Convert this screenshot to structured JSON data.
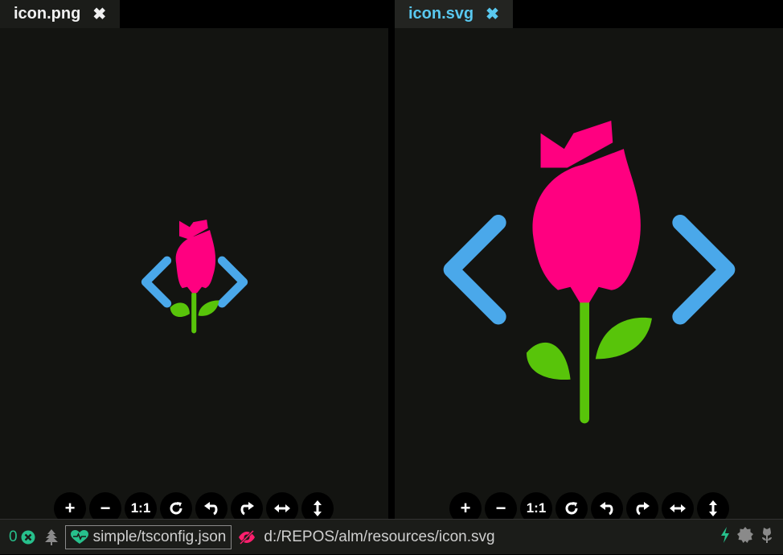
{
  "tabs": {
    "left": {
      "title": "icon.png",
      "close_glyph": "✖"
    },
    "right": {
      "title": "icon.svg",
      "close_glyph": "✖"
    }
  },
  "toolbar": {
    "zoom_in": "+",
    "zoom_out": "−",
    "actual_size": "1:1",
    "icons": [
      "plus-icon",
      "minus-icon",
      "actual-size-icon",
      "reset-icon",
      "rotate-left-icon",
      "rotate-right-icon",
      "flip-horizontal-icon",
      "flip-vertical-icon"
    ]
  },
  "statusbar": {
    "error_count": "0",
    "config": "simple/tsconfig.json",
    "path": "d:/REPOS/alm/resources/icon.svg"
  },
  "colors": {
    "accent": "#59c8ef",
    "rose": "#ff0080",
    "leaf": "#58c40a",
    "bracket": "#4aa8ea",
    "status_green": "#27c08c"
  }
}
